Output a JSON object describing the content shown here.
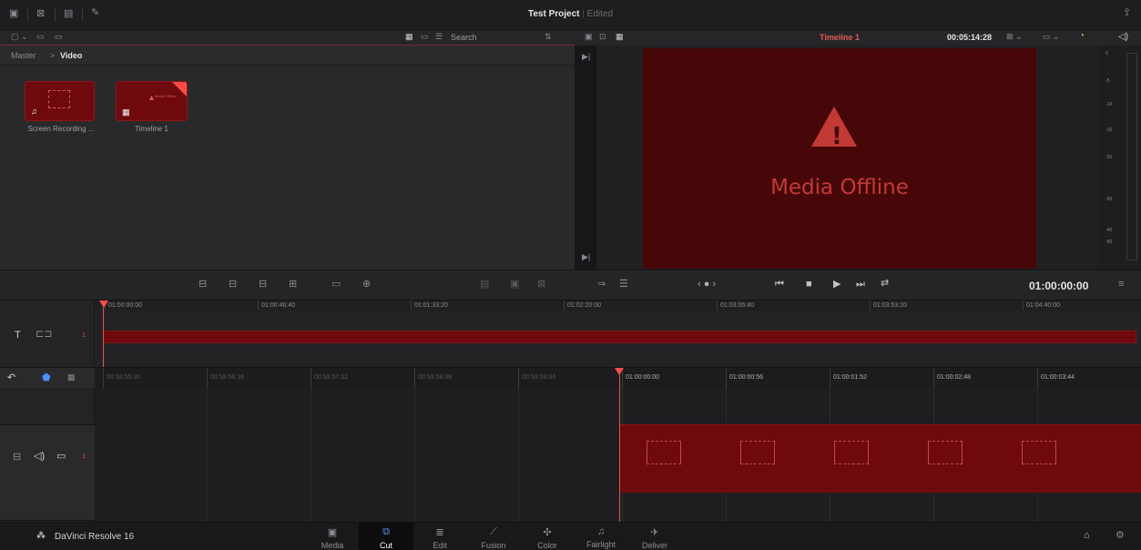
{
  "header": {
    "project": "Test Project",
    "status": "Edited"
  },
  "media_pool": {
    "search_placeholder": "Search",
    "breadcrumb": {
      "root": "Master",
      "sep": ">",
      "current": "Video"
    },
    "clips": [
      {
        "label": "Screen Recording ...",
        "kind": "audio-video"
      },
      {
        "label": "Timeline 1",
        "kind": "timeline",
        "thumb_text": "Media Offline"
      }
    ]
  },
  "viewer": {
    "title": "Timeline 1",
    "timecode": "00:05:14:28",
    "offline_text": "Media Offline",
    "current_time": "01:00:00:00"
  },
  "audio_meter": {
    "scale": [
      "0",
      "-5",
      "-10",
      "-15",
      "-20",
      "-30",
      "-40",
      "-50"
    ]
  },
  "upper_timeline": {
    "track_number": "1",
    "ticks": [
      "01:00:00:00",
      "01:00:46:40",
      "01:01:33:20",
      "01:02:20:00",
      "01:03:06:40",
      "01:03:53:20",
      "01:04:40:00"
    ]
  },
  "lower_timeline": {
    "track_number": "1",
    "ticks_before": [
      "00:59:55:20",
      "00:59:56:16",
      "00:59:57:12",
      "00:59:58:08",
      "00:59:59:04"
    ],
    "ticks_after": [
      "01:00:00:00",
      "01:00:00:56",
      "01:00:01:52",
      "01:00:02:48",
      "01:00:03:44"
    ]
  },
  "bottom": {
    "app_name": "DaVinci Resolve 16",
    "pages": [
      {
        "label": "Media",
        "icon": "media-page-icon",
        "glyph": "▣"
      },
      {
        "label": "Cut",
        "icon": "cut-page-icon",
        "glyph": "⧉"
      },
      {
        "label": "Edit",
        "icon": "edit-page-icon",
        "glyph": "≣"
      },
      {
        "label": "Fusion",
        "icon": "fusion-page-icon",
        "glyph": "⟋"
      },
      {
        "label": "Color",
        "icon": "color-page-icon",
        "glyph": "✣"
      },
      {
        "label": "Fairlight",
        "icon": "fairlight-page-icon",
        "glyph": "♫"
      },
      {
        "label": "Deliver",
        "icon": "deliver-page-icon",
        "glyph": "✈"
      }
    ],
    "active_page": "Cut"
  },
  "colors": {
    "accent_red": "#e0534e",
    "clip_red": "#6e0a0d",
    "viewer_red": "#470708",
    "offline_text": "#c23a36"
  }
}
